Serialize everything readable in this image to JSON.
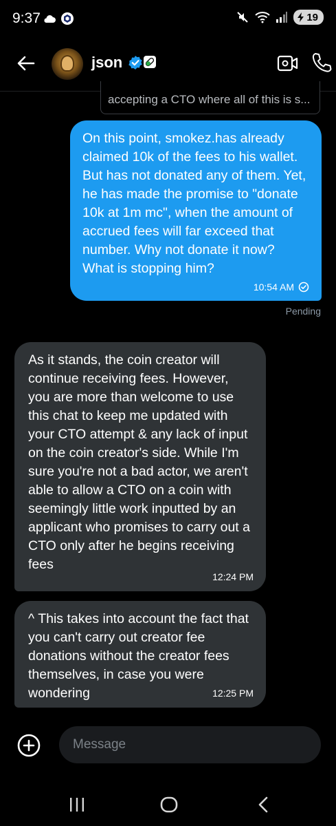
{
  "status_bar": {
    "time": "9:37",
    "battery_level": "19"
  },
  "header": {
    "contact_name": "json",
    "icons": [
      "back-arrow-icon",
      "verified-badge-icon",
      "pill-badge-icon",
      "video-call-icon",
      "phone-icon"
    ]
  },
  "quoted": {
    "text": "accepting a CTO where all of this is s..."
  },
  "messages": [
    {
      "direction": "sent",
      "text": "On this point, smokez.has already claimed 10k of the fees to his wallet. But has not donated any of them. Yet, he has made the promise to \"donate 10k at 1m mc\", when the amount of accrued fees will far exceed that number. Why not donate it now? What is stopping him?",
      "time": "10:54 AM",
      "status": "Pending"
    },
    {
      "direction": "received",
      "text": "As it stands, the coin creator will continue receiving fees. However, you are more than welcome to use this chat to keep me updated with your CTO attempt & any lack of input on the coin creator's side. While I'm sure you're not a bad actor, we aren't able to allow a CTO on a coin with seemingly little work inputted by an applicant who promises to carry out a CTO only after he begins receiving fees",
      "time": "12:24 PM"
    },
    {
      "direction": "received",
      "text": "^ This takes into account the fact that you can't carry out creator fee donations without the creator fees themselves, in case you were wondering",
      "time": "12:25 PM"
    }
  ],
  "composer": {
    "placeholder": "Message"
  },
  "colors": {
    "sent_bubble": "#1d9bf0",
    "received_bubble": "#2f3336",
    "background": "#000000"
  }
}
